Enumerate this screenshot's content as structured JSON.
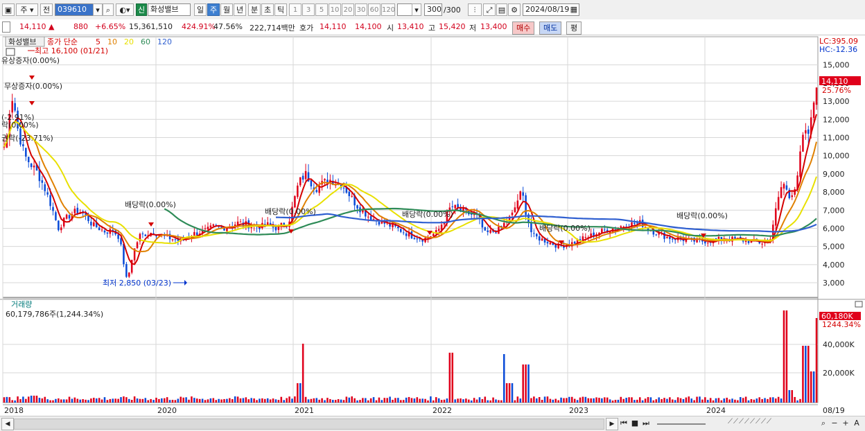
{
  "toolbar": {
    "period_selector": "주",
    "prev_label": "전",
    "code": "039610",
    "new_label": "신",
    "stock_name": "화성밸브",
    "tabs": [
      "일",
      "주",
      "월",
      "년",
      "분",
      "초",
      "틱"
    ],
    "selected_tab": "주",
    "intervals": [
      "1",
      "3",
      "5",
      "10",
      "20",
      "30",
      "60",
      "120"
    ],
    "count": "300",
    "count_total": "/300",
    "date": "2024/08/19"
  },
  "quote": {
    "price": "14,110",
    "change": "880",
    "change_pct": "+6.65%",
    "volume": "15,361,510",
    "volume_ratio": "424.91%",
    "turnover": "47.56%",
    "amount": "222,714백만",
    "ask_label": "호가",
    "ask": "14,110",
    "bid": "14,100",
    "open_label": "시",
    "open": "13,410",
    "high_label": "고",
    "high": "15,420",
    "low_label": "저",
    "low": "13,400",
    "buy_label": "매수",
    "sell_label": "매도",
    "eval_label": "평"
  },
  "legend": {
    "name": "화성밸브",
    "ma_prefix": "종가 단순",
    "ma": [
      {
        "label": "5",
        "color": "#d40000"
      },
      {
        "label": "10",
        "color": "#e08000"
      },
      {
        "label": "20",
        "color": "#e8e000"
      },
      {
        "label": "60",
        "color": "#2e8b57"
      },
      {
        "label": "120",
        "color": "#2f5fd0"
      }
    ]
  },
  "right_info": {
    "lc": "LC:395.09",
    "hc": "HC:-12.36",
    "price_tag": "14,110",
    "price_pct": "25.76%",
    "vol_tag": "60,180K",
    "vol_pct": "1244.34%"
  },
  "annotations": {
    "high": "최고 16,100 (01/21)",
    "low": "최저 2,850 (03/23)",
    "events": [
      {
        "text": "유상증자(0.00%)"
      },
      {
        "text": "무상증자(0.00%)"
      },
      {
        "text": "(-2.91%)"
      },
      {
        "text": "락(0.00%)"
      },
      {
        "text": "권락(-23.71%)"
      },
      {
        "text": "배당락(0.00%)"
      },
      {
        "text": "배당락(0.00%)"
      },
      {
        "text": "배당락(0.00%)"
      },
      {
        "text": "배당락(0.00%)"
      },
      {
        "text": "배당락(0.00%)"
      }
    ]
  },
  "volume_panel": {
    "label": "거래량",
    "value": "60,179,786주(1,244.34%)"
  },
  "x_labels": [
    "2018",
    "2020",
    "2021",
    "2022",
    "2023",
    "2024"
  ],
  "x_right_label": "08/19",
  "price_ticks": [
    "3,000",
    "4,000",
    "5,000",
    "6,000",
    "7,000",
    "8,000",
    "9,000",
    "10,000",
    "11,000",
    "12,000",
    "13,000",
    "14,000",
    "15,000"
  ],
  "volume_ticks": [
    "20,000K",
    "40,000K"
  ],
  "chart_data": {
    "type": "candlestick",
    "title": "화성밸브",
    "ylim": [
      2200,
      16400
    ],
    "x_range": [
      "2018-01",
      "2024-08"
    ],
    "series_price_points": [
      [
        0,
        10500
      ],
      [
        0.05,
        11200
      ],
      [
        0.1,
        13500
      ],
      [
        0.15,
        12800
      ],
      [
        0.2,
        11500
      ],
      [
        0.3,
        10000
      ],
      [
        0.4,
        9500
      ],
      [
        0.5,
        9000
      ],
      [
        0.6,
        8200
      ],
      [
        0.7,
        7200
      ],
      [
        0.8,
        6000
      ],
      [
        0.9,
        6500
      ],
      [
        1.0,
        6800
      ],
      [
        1.1,
        7000
      ],
      [
        1.2,
        6700
      ],
      [
        1.3,
        6200
      ],
      [
        1.4,
        6000
      ],
      [
        1.5,
        5800
      ],
      [
        1.6,
        5900
      ],
      [
        1.7,
        5500
      ],
      [
        1.75,
        4500
      ],
      [
        1.8,
        3200
      ],
      [
        1.85,
        3600
      ],
      [
        1.9,
        4600
      ],
      [
        2.0,
        5600
      ],
      [
        2.2,
        5800
      ],
      [
        2.4,
        5500
      ],
      [
        2.6,
        5300
      ],
      [
        2.8,
        5700
      ],
      [
        3.0,
        5900
      ],
      [
        3.1,
        6100
      ],
      [
        3.2,
        6000
      ],
      [
        3.3,
        6100
      ],
      [
        3.45,
        6300
      ],
      [
        3.6,
        6200
      ],
      [
        3.7,
        6100
      ],
      [
        3.8,
        6100
      ],
      [
        3.9,
        6200
      ],
      [
        4.0,
        6000
      ],
      [
        4.2,
        6300
      ],
      [
        4.35,
        8500
      ],
      [
        4.45,
        9000
      ],
      [
        4.6,
        8200
      ],
      [
        4.8,
        8700
      ],
      [
        5.0,
        8400
      ],
      [
        5.2,
        7300
      ],
      [
        5.4,
        6600
      ],
      [
        5.6,
        6300
      ],
      [
        5.8,
        6000
      ],
      [
        6.0,
        5600
      ],
      [
        6.2,
        5400
      ],
      [
        6.4,
        5800
      ],
      [
        6.6,
        7200
      ],
      [
        6.8,
        6900
      ],
      [
        7.0,
        6600
      ],
      [
        7.1,
        5700
      ],
      [
        7.3,
        5900
      ],
      [
        7.5,
        6700
      ],
      [
        7.6,
        7700
      ],
      [
        7.65,
        8000
      ],
      [
        7.7,
        7000
      ],
      [
        7.8,
        5600
      ],
      [
        8.0,
        5300
      ],
      [
        8.2,
        5000
      ],
      [
        8.4,
        5200
      ],
      [
        8.6,
        5500
      ],
      [
        8.8,
        5800
      ],
      [
        9.0,
        6000
      ],
      [
        9.2,
        6200
      ],
      [
        9.4,
        6300
      ],
      [
        9.6,
        5800
      ],
      [
        9.8,
        5500
      ],
      [
        10.0,
        5400
      ],
      [
        10.2,
        5300
      ],
      [
        10.4,
        5300
      ],
      [
        10.6,
        5400
      ],
      [
        10.8,
        5400
      ],
      [
        11.0,
        5300
      ],
      [
        11.2,
        5200
      ],
      [
        11.3,
        5200
      ],
      [
        11.4,
        7000
      ],
      [
        11.5,
        8600
      ],
      [
        11.6,
        7700
      ],
      [
        11.7,
        8500
      ],
      [
        11.8,
        11000
      ],
      [
        11.9,
        11300
      ],
      [
        12.0,
        14100
      ]
    ],
    "bars_sample_note": "weekly candles"
  }
}
